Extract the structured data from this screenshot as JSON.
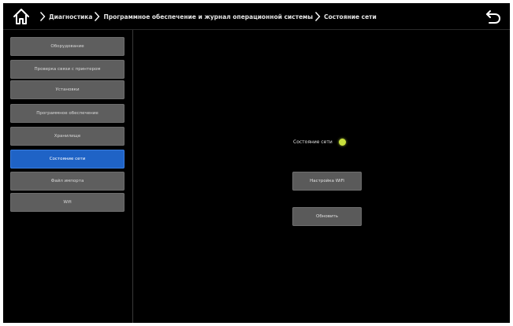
{
  "header": {
    "breadcrumb": [
      "Диагностика",
      "Программное обеспечение и журнал операционной системы",
      "Состояние сети"
    ],
    "home_icon": "home-icon",
    "back_icon": "back-arrow-icon"
  },
  "sidebar": {
    "items": [
      {
        "label": "Оборудование"
      },
      {
        "label": "Проверка связи с принтером"
      },
      {
        "label": "Установки"
      },
      {
        "label": "Программное обеспечение"
      },
      {
        "label": "Хранилище"
      },
      {
        "label": "Состояние сети"
      },
      {
        "label": "Файл импорта"
      },
      {
        "label": "Wifi"
      }
    ],
    "active_index": 5
  },
  "main": {
    "status_label": "Состояние сети",
    "status_color": "#c8e03c",
    "buttons": [
      {
        "label": "Настройка WiFi"
      },
      {
        "label": "Обновить"
      }
    ]
  },
  "colors": {
    "background": "#000000",
    "menu_item": "#5e5e5e",
    "menu_active": "#1f63c6",
    "button": "#5a5a5a",
    "text": "#e0e0e0"
  }
}
